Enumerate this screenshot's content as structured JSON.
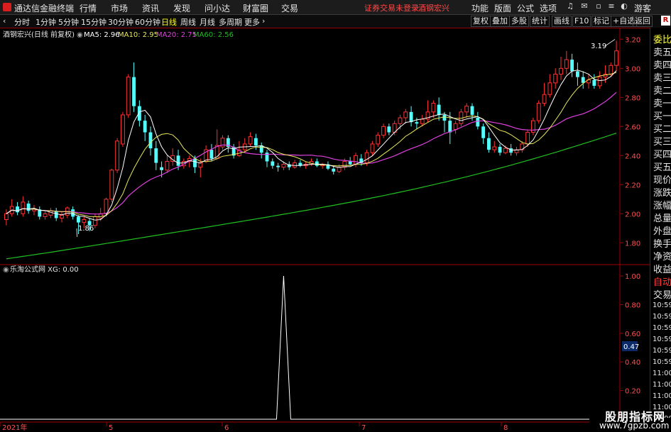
{
  "app": {
    "title": "通达信金融终端",
    "menu": [
      "行情",
      "市场",
      "资讯",
      "发现",
      "问小达",
      "财富圈",
      "交易"
    ],
    "warning": "证券交易未登录",
    "stock_name": "酒钢宏兴",
    "right_menu": [
      "功能",
      "版面",
      "公式",
      "选项"
    ],
    "visitor": "游客"
  },
  "toolbar": {
    "periods": [
      "分时",
      "1分钟",
      "5分钟",
      "15分钟",
      "30分钟",
      "60分钟",
      "日线",
      "周线",
      "月线",
      "多周期",
      "更多"
    ],
    "active": "日线",
    "right_buttons": [
      "复权",
      "叠加",
      "多股",
      "统计",
      "画线",
      "F10",
      "标记",
      "+自选",
      "返回"
    ],
    "r_badge": "R"
  },
  "main_chart": {
    "legend_title": "酒钢宏兴(日线 前复权)",
    "ma5": "MA5: 2.96",
    "ma10": "MA10: 2.95",
    "ma20": "MA20: 2.75",
    "ma60": "MA60: 2.56",
    "y_ticks": [
      "3.20",
      "3.00",
      "2.80",
      "2.60",
      "2.40",
      "2.20",
      "2.00",
      "1.80"
    ],
    "low_label": "1.86",
    "high_label": "3.19",
    "colors": {
      "ma5": "#ffffff",
      "ma10": "#e8e85a",
      "ma20": "#e040e0",
      "ma60": "#20c020",
      "up": "#ff3232",
      "down": "#54ffff"
    }
  },
  "indicator": {
    "legend": "乐淘公式网 XG: 0.00",
    "y_ticks": [
      "1.00",
      "0.80",
      "0.60",
      "0.40",
      "0.20"
    ],
    "current_value": "0.47"
  },
  "x_axis": {
    "labels": [
      "2021年",
      "5",
      "6",
      "7",
      "8"
    ]
  },
  "right_panel": {
    "items": [
      "委比",
      "卖五",
      "卖四",
      "卖三",
      "卖二",
      "卖一",
      "买一",
      "买二",
      "买三",
      "买四",
      "买五",
      "现价",
      "涨跌",
      "涨幅",
      "总量",
      "外盘",
      "换手",
      "净资",
      "收益"
    ],
    "auto_trade": [
      "自动",
      "交易"
    ],
    "times": [
      "10:59",
      "10:59",
      "10:59",
      "10:59",
      "10:59",
      "10:59",
      "11:00",
      "11:00",
      "11:00",
      "11:00",
      "11:00"
    ]
  },
  "watermark": {
    "line1": "股朋指标网",
    "line2": "www.7gpzb.com"
  },
  "chart_data": {
    "type": "candlestick",
    "candles": [
      [
        1.96,
        2.0,
        1.92,
        2.03
      ],
      [
        2.0,
        2.05,
        1.98,
        2.1
      ],
      [
        2.05,
        2.01,
        1.99,
        2.08
      ],
      [
        2.0,
        2.08,
        1.98,
        2.12
      ],
      [
        2.07,
        2.02,
        2.0,
        2.09
      ],
      [
        2.02,
        2.03,
        1.99,
        2.06
      ],
      [
        2.03,
        1.98,
        1.96,
        2.05
      ],
      [
        1.98,
        2.0,
        1.96,
        2.02
      ],
      [
        1.99,
        2.02,
        1.97,
        2.04
      ],
      [
        2.02,
        1.97,
        1.95,
        2.04
      ],
      [
        1.97,
        1.99,
        1.94,
        2.01
      ],
      [
        1.99,
        2.04,
        1.97,
        2.05
      ],
      [
        2.03,
        1.98,
        1.96,
        2.05
      ],
      [
        1.98,
        1.94,
        1.86,
        1.99
      ],
      [
        1.94,
        1.96,
        1.9,
        1.98
      ],
      [
        1.95,
        1.92,
        1.88,
        1.97
      ],
      [
        1.92,
        1.98,
        1.9,
        2.0
      ],
      [
        1.97,
        2.0,
        1.95,
        2.04
      ],
      [
        2.0,
        2.1,
        1.98,
        2.11
      ],
      [
        2.1,
        2.3,
        2.08,
        2.31
      ],
      [
        2.3,
        2.5,
        2.28,
        2.52
      ],
      [
        2.48,
        2.68,
        2.46,
        2.7
      ],
      [
        2.68,
        2.94,
        2.66,
        2.96
      ],
      [
        2.94,
        2.74,
        2.7,
        3.04
      ],
      [
        2.74,
        2.64,
        2.6,
        2.78
      ],
      [
        2.64,
        2.56,
        2.5,
        2.68
      ],
      [
        2.56,
        2.45,
        2.4,
        2.6
      ],
      [
        2.45,
        2.35,
        2.3,
        2.5
      ],
      [
        2.32,
        2.3,
        2.25,
        2.36
      ],
      [
        2.3,
        2.36,
        2.28,
        2.4
      ],
      [
        2.36,
        2.4,
        2.33,
        2.45
      ],
      [
        2.4,
        2.33,
        2.3,
        2.44
      ],
      [
        2.33,
        2.36,
        2.31,
        2.38
      ],
      [
        2.36,
        2.38,
        2.32,
        2.4
      ],
      [
        2.38,
        2.32,
        2.28,
        2.4
      ],
      [
        2.32,
        2.35,
        2.25,
        2.38
      ],
      [
        2.36,
        2.44,
        2.35,
        2.47
      ],
      [
        2.44,
        2.38,
        2.36,
        2.48
      ],
      [
        2.38,
        2.47,
        2.37,
        2.58
      ],
      [
        2.46,
        2.52,
        2.44,
        2.54
      ],
      [
        2.52,
        2.46,
        2.42,
        2.54
      ],
      [
        2.46,
        2.4,
        2.38,
        2.48
      ],
      [
        2.4,
        2.44,
        2.39,
        2.5
      ],
      [
        2.44,
        2.48,
        2.42,
        2.52
      ],
      [
        2.48,
        2.53,
        2.46,
        2.56
      ],
      [
        2.52,
        2.47,
        2.44,
        2.55
      ],
      [
        2.47,
        2.42,
        2.38,
        2.49
      ],
      [
        2.42,
        2.36,
        2.32,
        2.44
      ],
      [
        2.36,
        2.33,
        2.31,
        2.38
      ],
      [
        2.33,
        2.32,
        2.29,
        2.35
      ],
      [
        2.32,
        2.34,
        2.3,
        2.36
      ],
      [
        2.34,
        2.32,
        2.3,
        2.36
      ],
      [
        2.32,
        2.35,
        2.31,
        2.37
      ],
      [
        2.35,
        2.33,
        2.32,
        2.37
      ],
      [
        2.33,
        2.34,
        2.31,
        2.36
      ],
      [
        2.34,
        2.36,
        2.33,
        2.38
      ],
      [
        2.36,
        2.33,
        2.32,
        2.38
      ],
      [
        2.33,
        2.34,
        2.31,
        2.35
      ],
      [
        2.34,
        2.31,
        2.3,
        2.36
      ],
      [
        2.31,
        2.29,
        2.27,
        2.33
      ],
      [
        2.29,
        2.32,
        2.28,
        2.34
      ],
      [
        2.32,
        2.36,
        2.3,
        2.38
      ],
      [
        2.36,
        2.34,
        2.33,
        2.39
      ],
      [
        2.34,
        2.4,
        2.32,
        2.42
      ],
      [
        2.38,
        2.35,
        2.33,
        2.41
      ],
      [
        2.35,
        2.42,
        2.33,
        2.44
      ],
      [
        2.42,
        2.48,
        2.4,
        2.5
      ],
      [
        2.48,
        2.54,
        2.46,
        2.56
      ],
      [
        2.54,
        2.6,
        2.52,
        2.62
      ],
      [
        2.6,
        2.56,
        2.54,
        2.62
      ],
      [
        2.56,
        2.62,
        2.54,
        2.64
      ],
      [
        2.62,
        2.66,
        2.58,
        2.68
      ],
      [
        2.66,
        2.7,
        2.62,
        2.72
      ],
      [
        2.7,
        2.63,
        2.6,
        2.74
      ],
      [
        2.63,
        2.62,
        2.58,
        2.66
      ],
      [
        2.62,
        2.65,
        2.6,
        2.68
      ],
      [
        2.65,
        2.7,
        2.63,
        2.78
      ],
      [
        2.7,
        2.76,
        2.66,
        2.78
      ],
      [
        2.75,
        2.68,
        2.64,
        2.8
      ],
      [
        2.68,
        2.64,
        2.56,
        2.7
      ],
      [
        2.64,
        2.56,
        2.48,
        2.7
      ],
      [
        2.58,
        2.62,
        2.55,
        2.64
      ],
      [
        2.62,
        2.7,
        2.6,
        2.72
      ],
      [
        2.7,
        2.74,
        2.66,
        2.76
      ],
      [
        2.74,
        2.68,
        2.64,
        2.76
      ],
      [
        2.66,
        2.6,
        2.58,
        2.7
      ],
      [
        2.6,
        2.52,
        2.48,
        2.62
      ],
      [
        2.52,
        2.44,
        2.42,
        2.56
      ],
      [
        2.44,
        2.46,
        2.42,
        2.5
      ],
      [
        2.46,
        2.42,
        2.4,
        2.48
      ],
      [
        2.42,
        2.45,
        2.41,
        2.47
      ],
      [
        2.45,
        2.42,
        2.4,
        2.48
      ],
      [
        2.42,
        2.44,
        2.4,
        2.46
      ],
      [
        2.44,
        2.48,
        2.42,
        2.5
      ],
      [
        2.48,
        2.56,
        2.46,
        2.58
      ],
      [
        2.56,
        2.64,
        2.54,
        2.66
      ],
      [
        2.64,
        2.76,
        2.62,
        2.78
      ],
      [
        2.76,
        2.82,
        2.74,
        2.9
      ],
      [
        2.82,
        2.9,
        2.8,
        2.96
      ],
      [
        2.9,
        2.96,
        2.86,
        3.0
      ],
      [
        2.96,
        3.0,
        2.92,
        3.08
      ],
      [
        3.0,
        3.06,
        2.96,
        3.12
      ],
      [
        3.06,
        2.98,
        2.94,
        3.1
      ],
      [
        2.98,
        2.94,
        2.88,
        3.04
      ],
      [
        2.94,
        2.9,
        2.86,
        2.98
      ],
      [
        2.9,
        2.92,
        2.86,
        2.96
      ],
      [
        2.92,
        2.88,
        2.86,
        2.96
      ],
      [
        2.88,
        2.94,
        2.86,
        2.98
      ],
      [
        2.94,
        2.96,
        2.9,
        3.02
      ],
      [
        2.96,
        3.02,
        2.94,
        3.04
      ],
      [
        3.02,
        3.12,
        2.98,
        3.19
      ]
    ],
    "ma60_start": 1.69,
    "ma60_end": 2.56,
    "xg_signal_index": 50,
    "ylim": [
      1.66,
      3.27
    ]
  }
}
